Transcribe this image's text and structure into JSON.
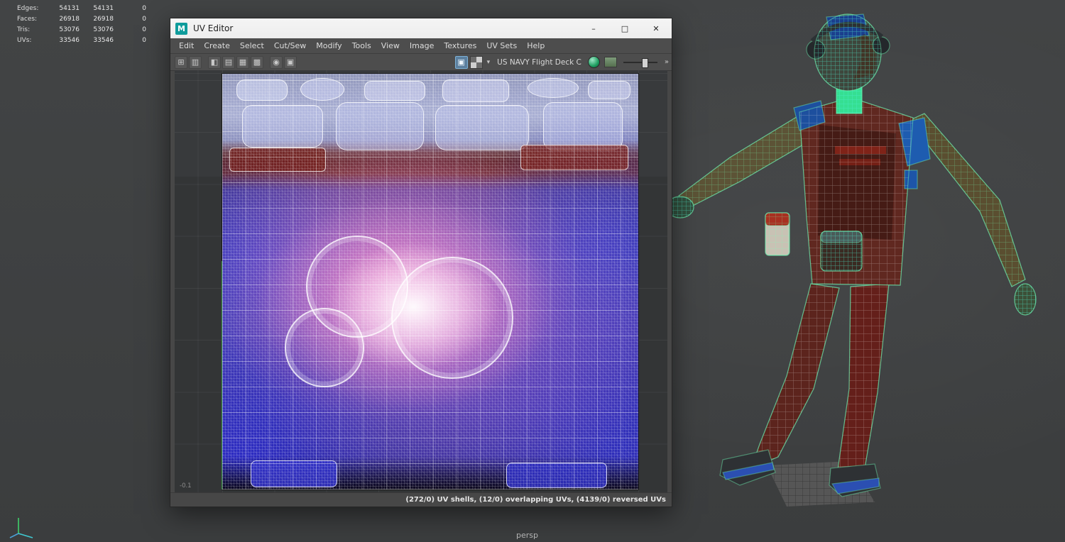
{
  "colors": {
    "maya_teal": "#0f9c9c",
    "selection_blue": "#5b7f9e",
    "wire_green": "#6cf0b4",
    "uv_pink": "#e07ec0",
    "uv_blue": "#3c3cae"
  },
  "stats": {
    "rows": [
      {
        "label": "Edges:",
        "current": "54131",
        "total": "54131",
        "delta": "0"
      },
      {
        "label": "Faces:",
        "current": "26918",
        "total": "26918",
        "delta": "0"
      },
      {
        "label": "Tris:",
        "current": "53076",
        "total": "53076",
        "delta": "0"
      },
      {
        "label": "UVs:",
        "current": "33546",
        "total": "33546",
        "delta": "0"
      }
    ]
  },
  "uv_editor": {
    "title": "UV Editor",
    "logo_letter": "M",
    "window_controls": {
      "minimize": "–",
      "maximize": "□",
      "close": "✕"
    },
    "menu": [
      "Edit",
      "Create",
      "Select",
      "Cut/Sew",
      "Modify",
      "Tools",
      "View",
      "Image",
      "Textures",
      "UV Sets",
      "Help"
    ],
    "toolbar": {
      "left_icons": [
        "⊞",
        "▥",
        "◧",
        "▤",
        "▦",
        "▩",
        "◉",
        "▣"
      ],
      "active_icon": "▣",
      "dropdown_glyph": "▾",
      "texture_name": "US NAVY Flight Deck C",
      "expand_glyph": "»"
    },
    "canvas": {
      "axis_label": "-0.1"
    },
    "status_text": "(272/0) UV shells, (12/0) overlapping UVs, (4139/0) reversed UVs"
  },
  "viewport": {
    "camera_label": "persp"
  }
}
